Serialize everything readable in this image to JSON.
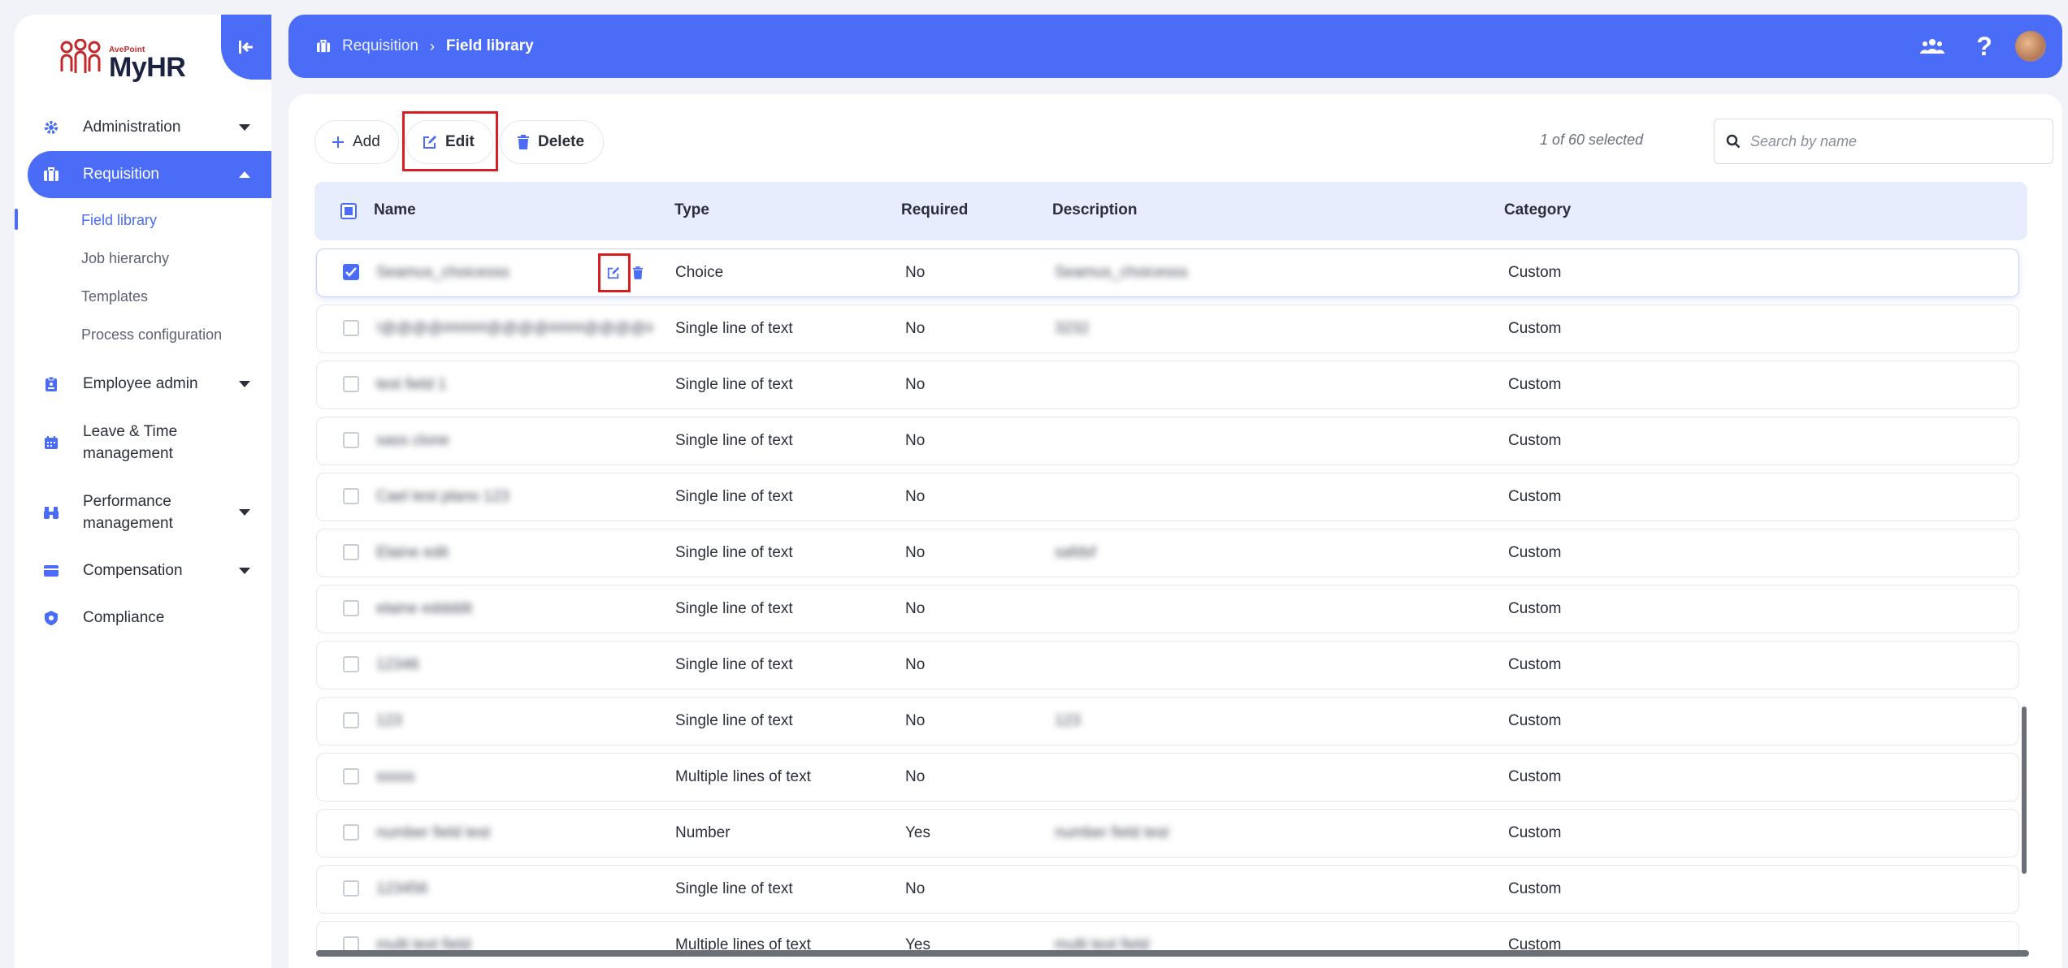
{
  "app": {
    "brand_small": "AvePoint",
    "brand_name": "MyHR"
  },
  "sidebar": {
    "items": [
      {
        "label": "Administration",
        "icon": "gear-icon",
        "expandable": true
      },
      {
        "label": "Requisition",
        "icon": "briefcase-icon",
        "expandable": true,
        "active": true
      },
      {
        "label": "Employee admin",
        "icon": "clipboard-badge-icon",
        "expandable": true
      },
      {
        "label": "Leave & Time management",
        "icon": "calendar-icon",
        "expandable": false
      },
      {
        "label": "Performance management",
        "icon": "binoculars-icon",
        "expandable": true
      },
      {
        "label": "Compensation",
        "icon": "wallet-icon",
        "expandable": true
      },
      {
        "label": "Compliance",
        "icon": "shield-gear-icon",
        "expandable": false
      }
    ],
    "requisition_sub": [
      {
        "label": "Field library",
        "current": true
      },
      {
        "label": "Job hierarchy"
      },
      {
        "label": "Templates"
      },
      {
        "label": "Process configuration"
      }
    ]
  },
  "header": {
    "breadcrumb_1": "Requisition",
    "breadcrumb_2": "Field library"
  },
  "toolbar": {
    "add_label": "Add",
    "edit_label": "Edit",
    "delete_label": "Delete",
    "selection_status": "1 of 60 selected",
    "search_placeholder": "Search by name"
  },
  "table": {
    "columns": [
      "Name",
      "Type",
      "Required",
      "Description",
      "Category"
    ],
    "rows": [
      {
        "name": "Seamus_choicesss",
        "type": "Choice",
        "required": "No",
        "description": "Seamus_choicesss",
        "category": "Custom",
        "selected": true
      },
      {
        "name": "!@@@@#####@@@@####@@@@####",
        "type": "Single line of text",
        "required": "No",
        "description": "3232",
        "category": "Custom"
      },
      {
        "name": "test field 1",
        "type": "Single line of text",
        "required": "No",
        "description": "",
        "category": "Custom"
      },
      {
        "name": "sass clone",
        "type": "Single line of text",
        "required": "No",
        "description": "",
        "category": "Custom"
      },
      {
        "name": "Cael test plano 123",
        "type": "Single line of text",
        "required": "No",
        "description": "",
        "category": "Custom"
      },
      {
        "name": "Elaine edit",
        "type": "Single line of text",
        "required": "No",
        "description": "safdsf",
        "category": "Custom"
      },
      {
        "name": "elaine eddddit",
        "type": "Single line of text",
        "required": "No",
        "description": "",
        "category": "Custom"
      },
      {
        "name": "12346",
        "type": "Single line of text",
        "required": "No",
        "description": "",
        "category": "Custom"
      },
      {
        "name": "123",
        "type": "Single line of text",
        "required": "No",
        "description": "123",
        "category": "Custom"
      },
      {
        "name": "sssss",
        "type": "Multiple lines of text",
        "required": "No",
        "description": "",
        "category": "Custom"
      },
      {
        "name": "number field test",
        "type": "Number",
        "required": "Yes",
        "description": "number field test",
        "category": "Custom"
      },
      {
        "name": "123456",
        "type": "Single line of text",
        "required": "No",
        "description": "",
        "category": "Custom"
      },
      {
        "name": "multi text field",
        "type": "Multiple lines of text",
        "required": "Yes",
        "description": "multi text field",
        "category": "Custom"
      }
    ]
  },
  "colors": {
    "accent": "#4a6cf7",
    "highlight": "#d81e23",
    "header_row_bg": "#e8edfd"
  }
}
